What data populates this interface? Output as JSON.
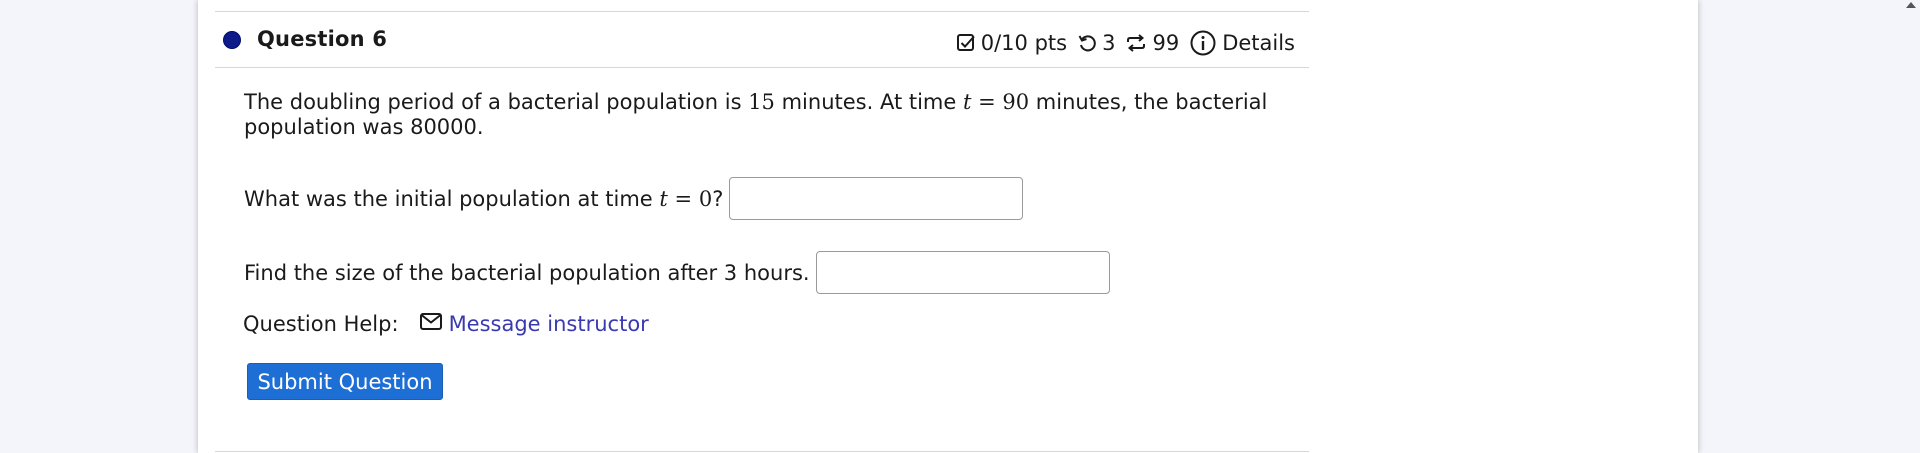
{
  "question": {
    "title": "Question 6",
    "status_color": "#0d1a8a"
  },
  "meta": {
    "score": "0/10 pts",
    "score_icon": "checkbox-icon",
    "retries": "3",
    "retries_icon": "undo-icon",
    "attempts": "99",
    "attempts_icon": "repeat-icon",
    "details_label": "Details",
    "details_icon": "info-icon"
  },
  "body": {
    "p1_a": "The doubling period of a bacterial population is ",
    "p1_num1": "15",
    "p1_b": " minutes. At time ",
    "p1_var": "t",
    "p1_eq": " = ",
    "p1_num2": "90",
    "p1_c": " minutes, the bacterial population was 80000.",
    "q1_a": "What was the initial population at time ",
    "q1_var": "t",
    "q1_eq": " = ",
    "q1_num": "0",
    "q1_b": "?",
    "q1_value": "",
    "q2": "Find the size of the bacterial population after 3 hours.",
    "q2_value": ""
  },
  "help": {
    "label": "Question Help:",
    "link_label": "Message instructor",
    "link_icon": "mail-icon",
    "link_color": "#3a3ab0"
  },
  "actions": {
    "submit_label": "Submit Question",
    "submit_color": "#1d6fd6"
  }
}
